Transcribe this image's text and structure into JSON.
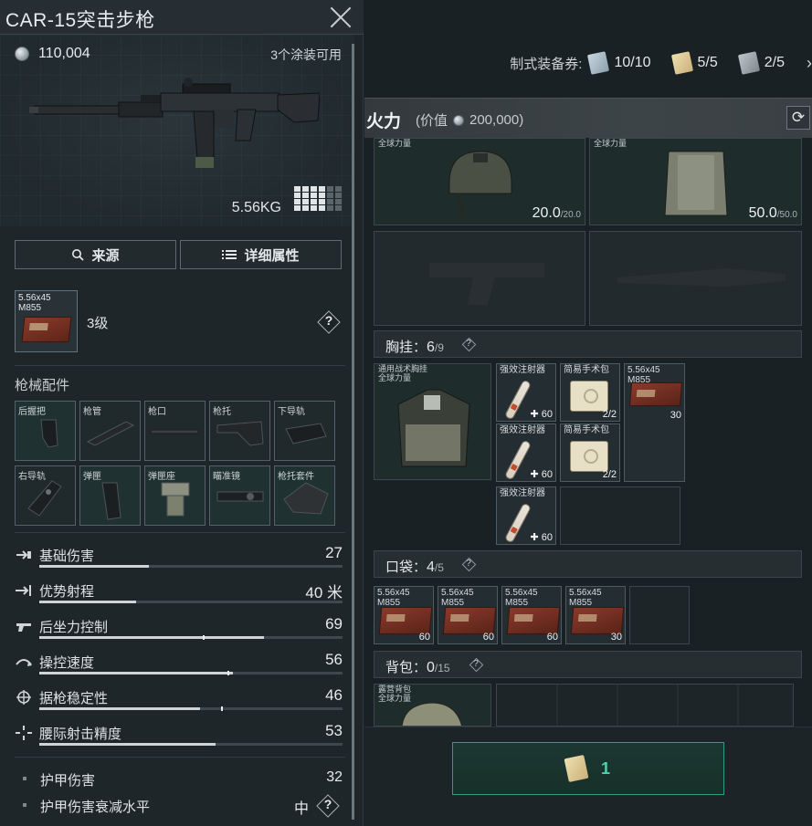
{
  "weapon": {
    "title": "CAR-15突击步枪",
    "price": "110,004",
    "skins_available": "3个涂装可用",
    "weight": "5.56KG",
    "grade_icon": "grade-grid-icon"
  },
  "buttons": {
    "source": "来源",
    "details": "详细属性"
  },
  "ammo": {
    "name_line1": "5.56x45",
    "name_line2": "M855",
    "level": "3级"
  },
  "attachments": {
    "section_label": "枪械配件",
    "slots": [
      {
        "label": "后握把"
      },
      {
        "label": "枪管"
      },
      {
        "label": "枪口"
      },
      {
        "label": "枪托"
      },
      {
        "label": "下导轨"
      },
      {
        "label": "右导轨"
      },
      {
        "label": "弹匣"
      },
      {
        "label": "弹匣座"
      },
      {
        "label": "瞄准镜"
      },
      {
        "label": "枪托套件"
      }
    ]
  },
  "stats": [
    {
      "name": "基础伤害",
      "value": "27",
      "level": 0.36
    },
    {
      "name": "优势射程",
      "value": "40 米",
      "level": 0.32
    },
    {
      "name": "后坐力控制",
      "value": "69",
      "level": 0.74
    },
    {
      "name": "操控速度",
      "value": "56",
      "level": 0.64
    },
    {
      "name": "据枪稳定性",
      "value": "46",
      "level": 0.53
    },
    {
      "name": "腰际射击精度",
      "value": "53",
      "level": 0.58
    }
  ],
  "sub_stats": [
    {
      "name": "护甲伤害",
      "value": "32"
    },
    {
      "name": "护甲伤害衰减水平",
      "value": "中"
    }
  ],
  "tickets": {
    "label": "制式装备券:",
    "items": [
      {
        "value": "10/10",
        "color": "#9fb3c1"
      },
      {
        "value": "5/5",
        "color": "#d9c690"
      },
      {
        "value": "2/5",
        "color": "#9aa3a8"
      }
    ]
  },
  "loadout": {
    "title": "火力",
    "value_prefix": "(价值",
    "value": "200,000)",
    "refresh_icon": "refresh-icon"
  },
  "gear": {
    "helmet": {
      "tag": "全球力量",
      "durability": "20.0",
      "max": "/20.0"
    },
    "armor": {
      "tag": "全球力量",
      "durability": "50.0",
      "max": "/50.0"
    }
  },
  "chest_rig": {
    "label": "胸挂：",
    "used": "6",
    "cap": "/9",
    "item_name": "通用战术胸挂",
    "item_tag": "全球力量",
    "items": [
      {
        "name": "强效注射器",
        "count": "60"
      },
      {
        "name": "简易手术包",
        "count": "2/2"
      },
      {
        "name": "5.56x45",
        "sub": "M855",
        "count": "30"
      },
      {
        "name": "强效注射器",
        "count": "60"
      },
      {
        "name": "简易手术包",
        "count": "2/2"
      },
      {
        "name": "强效注射器",
        "count": "60"
      }
    ]
  },
  "pockets": {
    "label": "口袋：",
    "used": "4",
    "cap": "/5",
    "items": [
      {
        "name": "5.56x45",
        "sub": "M855",
        "count": "60"
      },
      {
        "name": "5.56x45",
        "sub": "M855",
        "count": "60"
      },
      {
        "name": "5.56x45",
        "sub": "M855",
        "count": "60"
      },
      {
        "name": "5.56x45",
        "sub": "M855",
        "count": "30"
      }
    ]
  },
  "backpack": {
    "label": "背包：",
    "used": "0",
    "cap": "/15",
    "item_name": "露营背包",
    "item_tag": "全球力量"
  },
  "confirm": {
    "count": "1"
  }
}
